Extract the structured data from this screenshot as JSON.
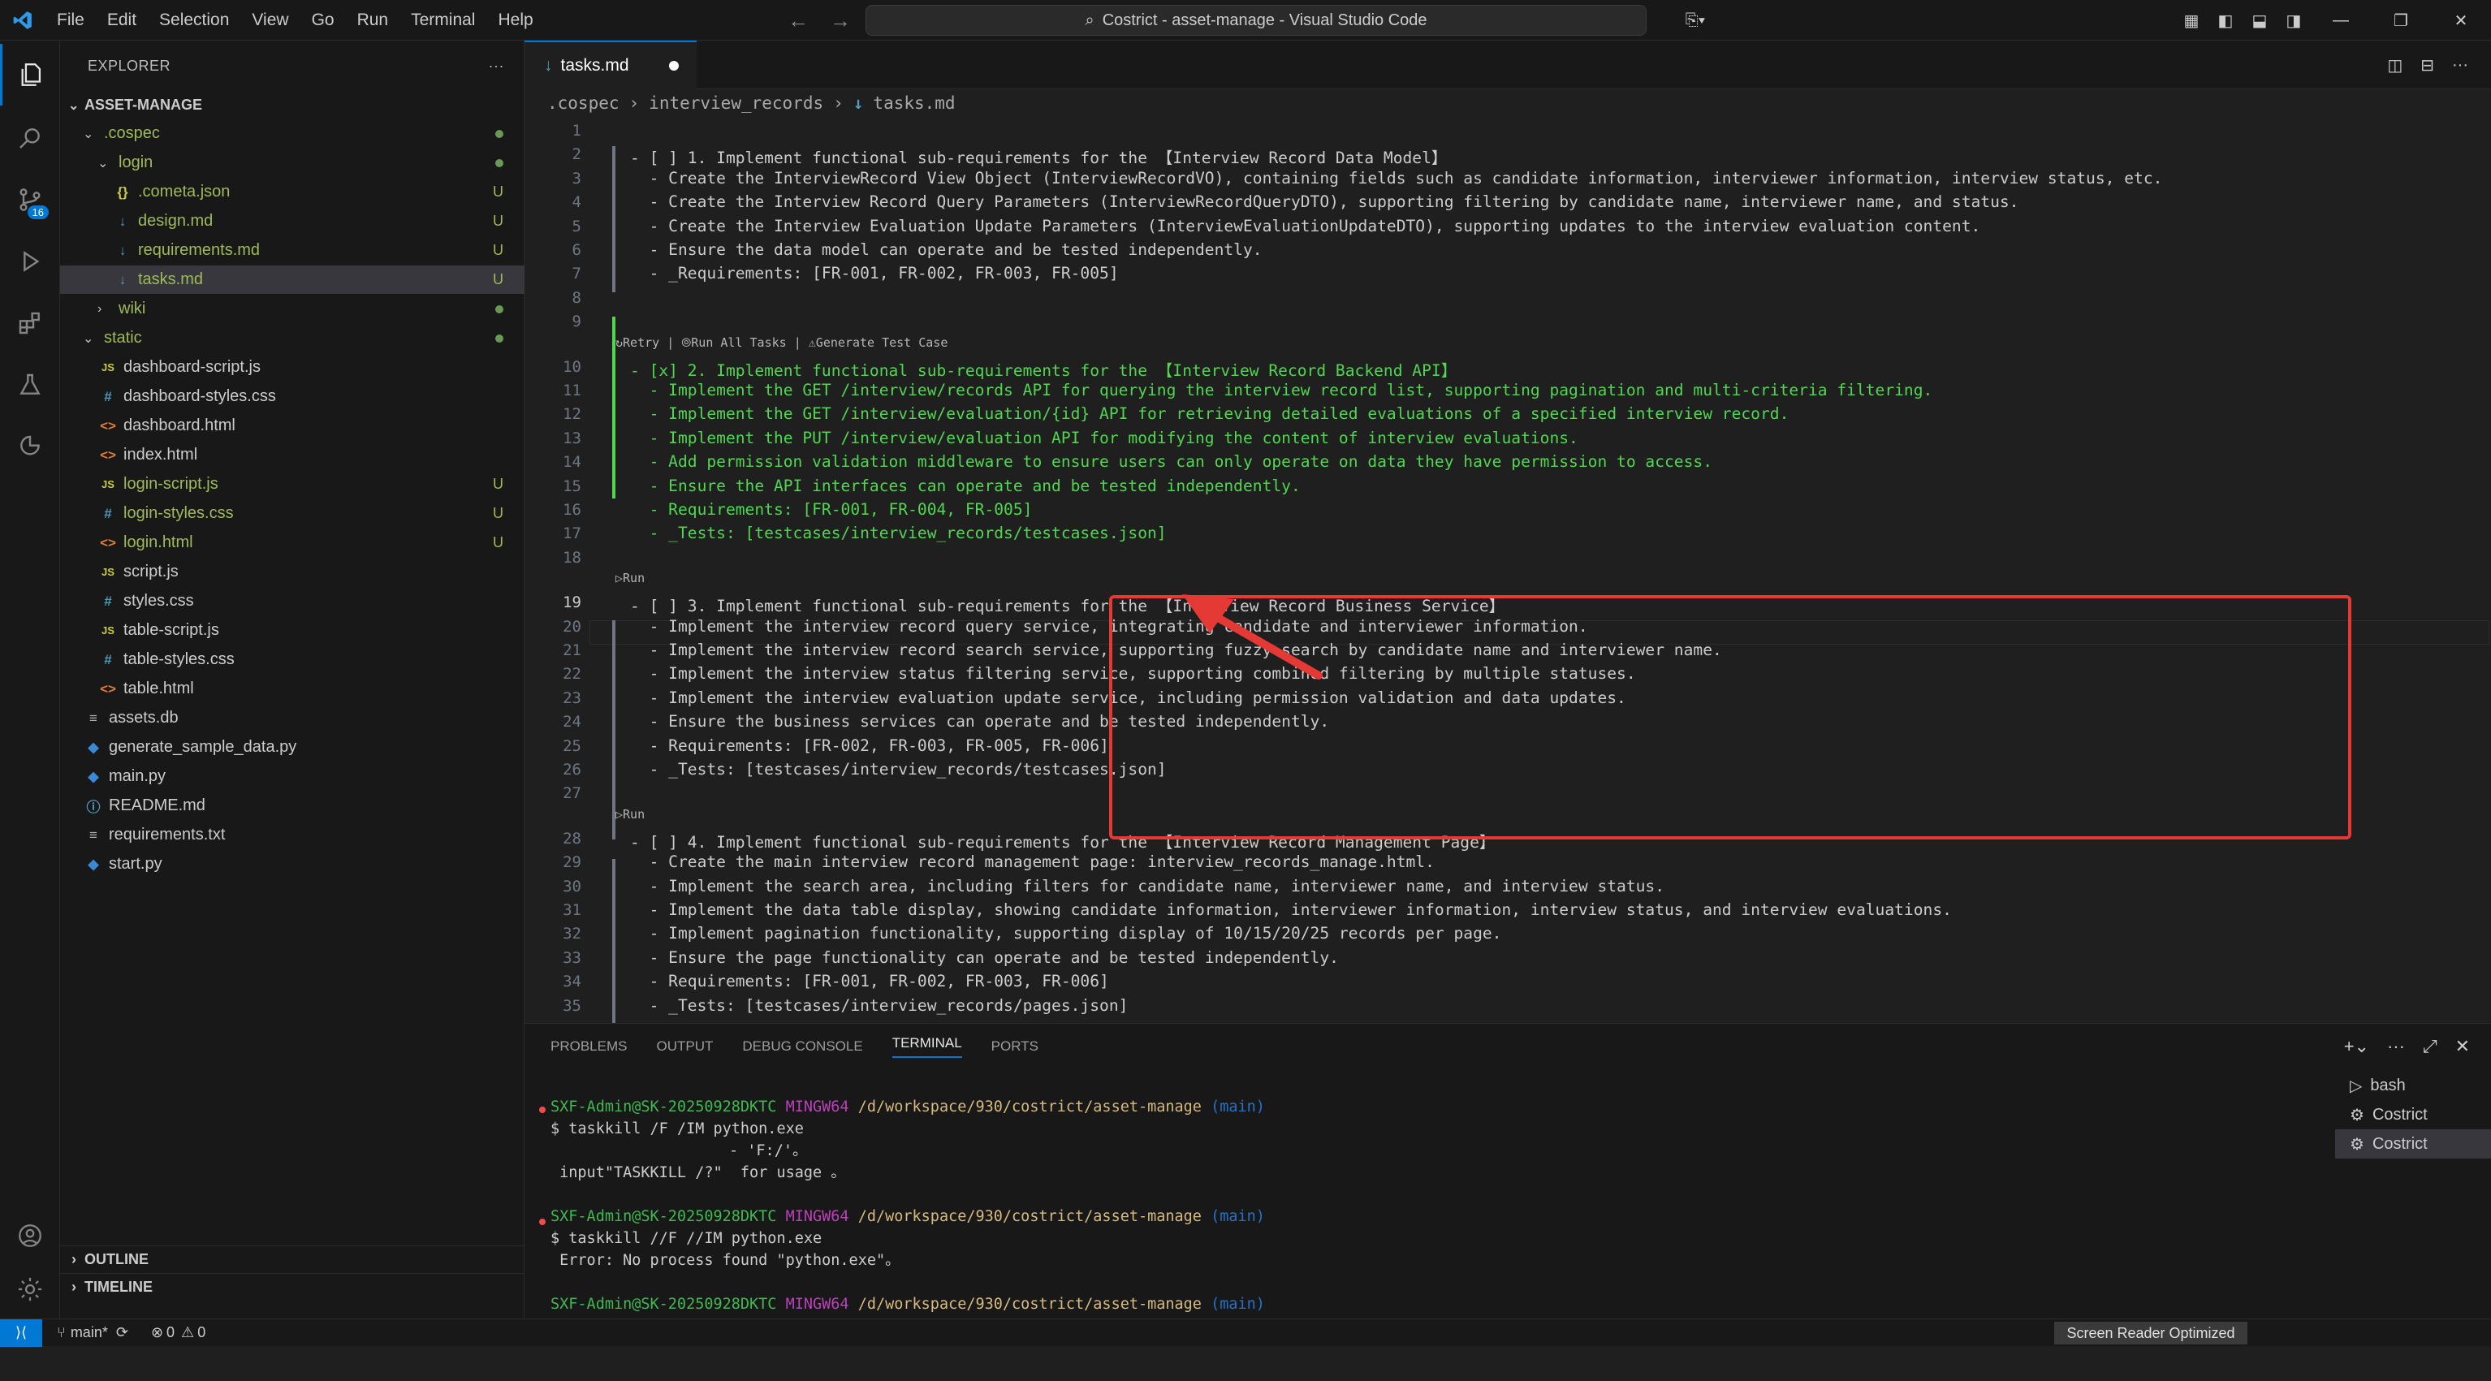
{
  "titlebar": {
    "menu": [
      "File",
      "Edit",
      "Selection",
      "View",
      "Go",
      "Run",
      "Terminal",
      "Help"
    ],
    "search_text": "Costrict - asset-manage - Visual Studio Code"
  },
  "activity": {
    "scm_badge": "16"
  },
  "explorer": {
    "title": "EXPLORER",
    "more": "···",
    "root": "ASSET-MANAGE",
    "items": [
      {
        "label": ".cospec",
        "kind": "folder-open",
        "depth": 1,
        "status": "dot",
        "color": "#9fb95b"
      },
      {
        "label": "login",
        "kind": "folder-open",
        "depth": 2,
        "status": "dot",
        "color": "#9fb95b"
      },
      {
        "label": ".cometa.json",
        "kind": "json",
        "depth": 3,
        "status": "U",
        "color": "#9fb95b"
      },
      {
        "label": "design.md",
        "kind": "md",
        "depth": 3,
        "status": "U",
        "color": "#9fb95b"
      },
      {
        "label": "requirements.md",
        "kind": "md",
        "depth": 3,
        "status": "U",
        "color": "#9fb95b"
      },
      {
        "label": "tasks.md",
        "kind": "md",
        "depth": 3,
        "status": "U",
        "color": "#9fb95b",
        "selected": true
      },
      {
        "label": "wiki",
        "kind": "folder",
        "depth": 2,
        "status": "dot",
        "color": "#9fb95b"
      },
      {
        "label": "static",
        "kind": "folder-open",
        "depth": 1,
        "status": "dot",
        "color": "#9fb95b"
      },
      {
        "label": "dashboard-script.js",
        "kind": "js",
        "depth": 2,
        "status": "",
        "color": "#cccccc"
      },
      {
        "label": "dashboard-styles.css",
        "kind": "css",
        "depth": 2,
        "status": "",
        "color": "#cccccc"
      },
      {
        "label": "dashboard.html",
        "kind": "html",
        "depth": 2,
        "status": "",
        "color": "#cccccc"
      },
      {
        "label": "index.html",
        "kind": "html",
        "depth": 2,
        "status": "",
        "color": "#cccccc"
      },
      {
        "label": "login-script.js",
        "kind": "js",
        "depth": 2,
        "status": "U",
        "color": "#9fb95b"
      },
      {
        "label": "login-styles.css",
        "kind": "css",
        "depth": 2,
        "status": "U",
        "color": "#9fb95b"
      },
      {
        "label": "login.html",
        "kind": "html",
        "depth": 2,
        "status": "U",
        "color": "#9fb95b"
      },
      {
        "label": "script.js",
        "kind": "js",
        "depth": 2,
        "status": "",
        "color": "#cccccc"
      },
      {
        "label": "styles.css",
        "kind": "css",
        "depth": 2,
        "status": "",
        "color": "#cccccc"
      },
      {
        "label": "table-script.js",
        "kind": "js",
        "depth": 2,
        "status": "",
        "color": "#cccccc"
      },
      {
        "label": "table-styles.css",
        "kind": "css",
        "depth": 2,
        "status": "",
        "color": "#cccccc"
      },
      {
        "label": "table.html",
        "kind": "html",
        "depth": 2,
        "status": "",
        "color": "#cccccc"
      },
      {
        "label": "assets.db",
        "kind": "db",
        "depth": 1,
        "status": "",
        "color": "#cccccc"
      },
      {
        "label": "generate_sample_data.py",
        "kind": "py",
        "depth": 1,
        "status": "",
        "color": "#cccccc"
      },
      {
        "label": "main.py",
        "kind": "py",
        "depth": 1,
        "status": "",
        "color": "#cccccc"
      },
      {
        "label": "README.md",
        "kind": "info",
        "depth": 1,
        "status": "",
        "color": "#cccccc"
      },
      {
        "label": "requirements.txt",
        "kind": "txt",
        "depth": 1,
        "status": "",
        "color": "#cccccc"
      },
      {
        "label": "start.py",
        "kind": "py",
        "depth": 1,
        "status": "",
        "color": "#cccccc"
      }
    ],
    "outline": "OUTLINE",
    "timeline": "TIMELINE"
  },
  "editor": {
    "tab_label": "tasks.md",
    "breadcrumb": [
      ".cospec",
      "interview_records",
      "tasks.md"
    ],
    "lines": [
      {
        "n": "1",
        "t": ""
      },
      {
        "n": "2",
        "t": "- [ ] 1. Implement functional sub-requirements for the 【Interview Record Data Model】"
      },
      {
        "n": "3",
        "t": "  - Create the InterviewRecord View Object (InterviewRecordVO), containing fields such as candidate information, interviewer information, interview status, etc."
      },
      {
        "n": "4",
        "t": "  - Create the Interview Record Query Parameters (InterviewRecordQueryDTO), supporting filtering by candidate name, interviewer name, and status."
      },
      {
        "n": "5",
        "t": "  - Create the Interview Evaluation Update Parameters (InterviewEvaluationUpdateDTO), supporting updates to the interview evaluation content."
      },
      {
        "n": "6",
        "t": "  - Ensure the data model can operate and be tested independently."
      },
      {
        "n": "7",
        "t": "  - _Requirements: [FR-001, FR-002, FR-003, FR-005]"
      },
      {
        "n": "8",
        "t": ""
      },
      {
        "n": "9",
        "t": ""
      },
      {
        "lens": "↻Retry | ⦾Run All Tasks | ⚠Generate Test Case"
      },
      {
        "n": "10",
        "t": "- [x] 2. Implement functional sub-requirements for the 【Interview Record Backend API】",
        "g": true
      },
      {
        "n": "11",
        "t": "  - Implement the GET /interview/records API for querying the interview record list, supporting pagination and multi-criteria filtering.",
        "g": true
      },
      {
        "n": "12",
        "t": "  - Implement the GET /interview/evaluation/{id} API for retrieving detailed evaluations of a specified interview record.",
        "g": true
      },
      {
        "n": "13",
        "t": "  - Implement the PUT /interview/evaluation API for modifying the content of interview evaluations.",
        "g": true
      },
      {
        "n": "14",
        "t": "  - Add permission validation middleware to ensure users can only operate on data they have permission to access.",
        "g": true
      },
      {
        "n": "15",
        "t": "  - Ensure the API interfaces can operate and be tested independently.",
        "g": true
      },
      {
        "n": "16",
        "t": "  - Requirements: [FR-001, FR-004, FR-005]",
        "g": true
      },
      {
        "n": "17",
        "t": "  - _Tests: [testcases/interview_records/testcases.json]",
        "g": true
      },
      {
        "n": "18",
        "t": ""
      },
      {
        "lens": "▷Run"
      },
      {
        "n": "19",
        "t": "- [ ] 3. Implement functional sub-requirements for the 【Interview Record Business Service】",
        "cur": true
      },
      {
        "n": "20",
        "t": "  - Implement the interview record query service, integrating candidate and interviewer information."
      },
      {
        "n": "21",
        "t": "  - Implement the interview record search service, supporting fuzzy search by candidate name and interviewer name."
      },
      {
        "n": "22",
        "t": "  - Implement the interview status filtering service, supporting combined filtering by multiple statuses."
      },
      {
        "n": "23",
        "t": "  - Implement the interview evaluation update service, including permission validation and data updates."
      },
      {
        "n": "24",
        "t": "  - Ensure the business services can operate and be tested independently."
      },
      {
        "n": "25",
        "t": "  - Requirements: [FR-002, FR-003, FR-005, FR-006]"
      },
      {
        "n": "26",
        "t": "  - _Tests: [testcases/interview_records/testcases.json]"
      },
      {
        "n": "27",
        "t": ""
      },
      {
        "lens": "▷Run"
      },
      {
        "n": "28",
        "t": "- [ ] 4. Implement functional sub-requirements for the 【Interview Record Management Page】"
      },
      {
        "n": "29",
        "t": "  - Create the main interview record management page: interview_records_manage.html."
      },
      {
        "n": "30",
        "t": "  - Implement the search area, including filters for candidate name, interviewer name, and interview status."
      },
      {
        "n": "31",
        "t": "  - Implement the data table display, showing candidate information, interviewer information, interview status, and interview evaluations."
      },
      {
        "n": "32",
        "t": "  - Implement pagination functionality, supporting display of 10/15/20/25 records per page."
      },
      {
        "n": "33",
        "t": "  - Ensure the page functionality can operate and be tested independently."
      },
      {
        "n": "34",
        "t": "  - Requirements: [FR-001, FR-002, FR-003, FR-006]"
      },
      {
        "n": "35",
        "t": "  - _Tests: [testcases/interview_records/pages.json]"
      }
    ]
  },
  "panel": {
    "tabs": [
      "PROBLEMS",
      "OUTPUT",
      "DEBUG CONSOLE",
      "TERMINAL",
      "PORTS"
    ],
    "active_tab": "TERMINAL",
    "prompt_user": "SXF-Admin@SK-20250928DKTC",
    "prompt_sys": "MINGW64",
    "prompt_path": "/d/workspace/930/costrict/asset-manage",
    "prompt_branch": "(main)",
    "cmd1": "$ taskkill /F /IM python.exe",
    "out1a": "- 'F:/'。",
    "out1b": " input\"TASKKILL /?\"  for usage 。",
    "cmd2": "$ taskkill //F //IM python.exe",
    "out2": " Error: No process found \"python.exe\"。",
    "cmd3": "$ ",
    "terminals": [
      "bash",
      "Costrict",
      "Costrict"
    ]
  },
  "statusbar": {
    "branch": "main*",
    "errors": "0",
    "warnings": "0",
    "screen_reader": "Screen Reader Optimized"
  },
  "colors": {
    "accent": "#0078d4",
    "green": "#51d651",
    "highlight": "#e53935"
  }
}
